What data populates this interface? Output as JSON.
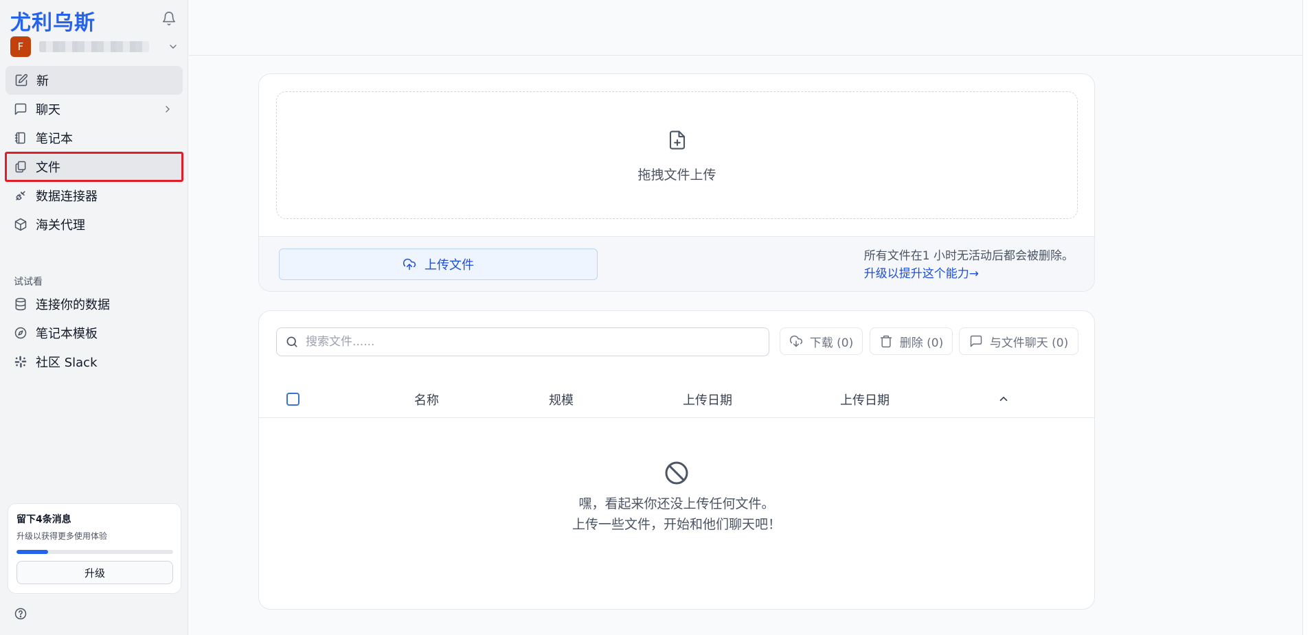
{
  "sidebar": {
    "brand": "尤利乌斯",
    "account": {
      "avatar_initial": "F"
    },
    "nav": [
      {
        "label": "新",
        "icon": "pencil-square-icon"
      },
      {
        "label": "聊天",
        "icon": "chat-bubble-icon"
      },
      {
        "label": "笔记本",
        "icon": "notebook-icon"
      },
      {
        "label": "文件",
        "icon": "files-icon"
      },
      {
        "label": "数据连接器",
        "icon": "plug-icon"
      },
      {
        "label": "海关代理",
        "icon": "cube-icon"
      }
    ],
    "section_label": "试试看",
    "try_items": [
      {
        "label": "连接你的数据",
        "icon": "database-icon"
      },
      {
        "label": "笔记本模板",
        "icon": "compass-icon"
      },
      {
        "label": "社区 Slack",
        "icon": "slack-icon"
      }
    ],
    "upgrade_card": {
      "title": "留下4条消息",
      "subtitle": "升级以获得更多使用体验",
      "progress": 0.2,
      "button": "升级"
    }
  },
  "upload": {
    "drop_text": "拖拽文件上传",
    "button_label": "上传文件",
    "note": "所有文件在1 小时无活动后都会被删除。",
    "note_link": "升级以提升这个能力→"
  },
  "files": {
    "search_placeholder": "搜索文件......",
    "download_label": "下载 (0)",
    "delete_label": "删除 (0)",
    "chat_label": "与文件聊天 (0)",
    "columns": [
      "名称",
      "规模",
      "上传日期",
      "上传日期"
    ],
    "empty_line1": "嘿，看起来你还没上传任何文件。",
    "empty_line2": "上传一些文件，开始和他们聊天吧！"
  },
  "colors": {
    "accent": "#2563eb",
    "selected_outline": "#e11d2a",
    "avatar": "#c2410c"
  }
}
